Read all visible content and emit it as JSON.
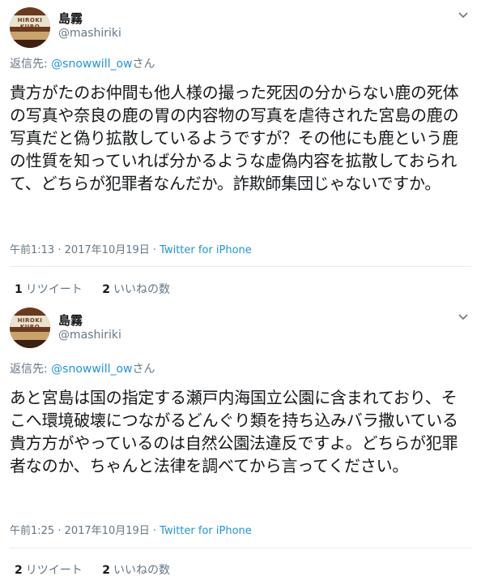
{
  "tweets": [
    {
      "author_name": "島霧",
      "author_handle": "@mashiriki",
      "avatar_text": "HIROKI KURO",
      "reply_prefix": "返信先: ",
      "reply_to": "@snowwill_ow",
      "reply_suffix": "さん",
      "text": "貴方がたのお仲間も他人様の撮った死因の分からない鹿の死体の写真や奈良の鹿の胃の内容物の写真を虐待された宮島の鹿の写真だと偽り拡散しているようですが？その他にも鹿という鹿の性質を知っていれば分かるような虚偽内容を拡散しておられて、どちらが犯罪者なんだか。詐欺師集団じゃないですか。",
      "timestamp": "午前1:13 · 2017年10月19日",
      "separator": " · ",
      "source": "Twitter for iPhone",
      "retweet_count": "1",
      "retweet_label": "リツイート",
      "like_count": "2",
      "like_label": "いいねの数"
    },
    {
      "author_name": "島霧",
      "author_handle": "@mashiriki",
      "avatar_text": "HIROKI KURO",
      "reply_prefix": "返信先: ",
      "reply_to": "@snowwill_ow",
      "reply_suffix": "さん",
      "text": "あと宮島は国の指定する瀬戸内海国立公園に含まれており、そこへ環境破壊につながるどんぐり類を持ち込みバラ撒いている貴方方がやっているのは自然公園法違反ですよ。どちらが犯罪者なのか、ちゃんと法律を調べてから言ってください。",
      "timestamp": "午前1:25 · 2017年10月19日",
      "separator": " · ",
      "source": "Twitter for iPhone",
      "retweet_count": "2",
      "retweet_label": "リツイート",
      "like_count": "2",
      "like_label": "いいねの数"
    }
  ],
  "colors": {
    "link": "#1b95e0",
    "muted": "#657786",
    "text": "#14171a",
    "divider": "#e6ecf0"
  }
}
